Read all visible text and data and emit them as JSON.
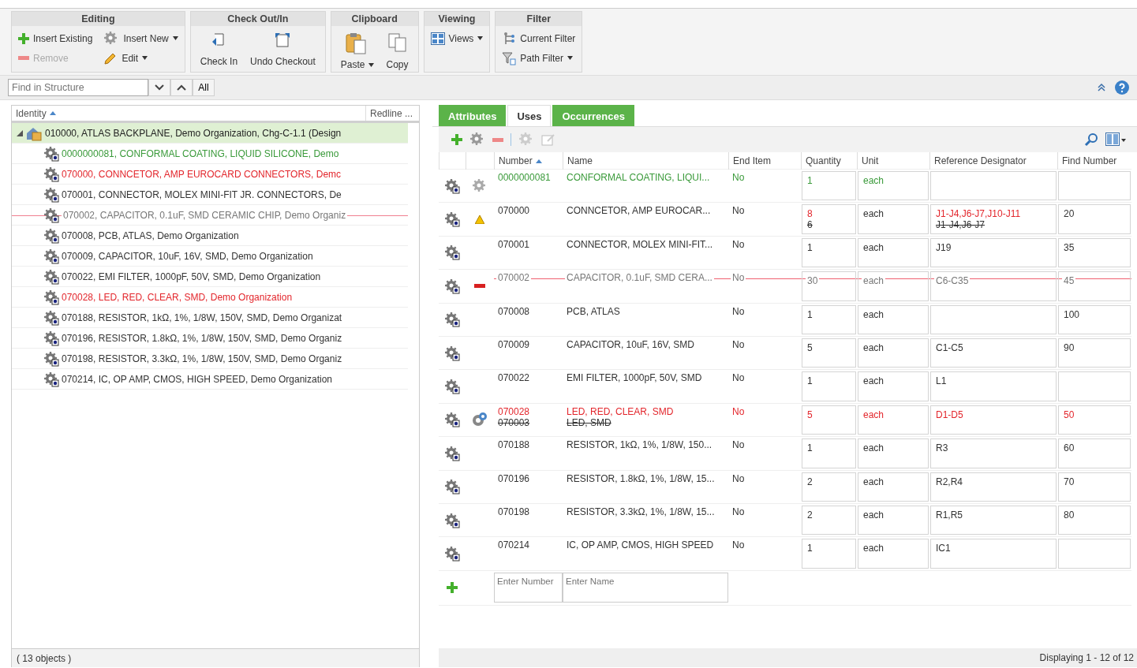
{
  "toolbar": {
    "groups": [
      {
        "title": "Editing",
        "kind": "small",
        "buttons": [
          {
            "label": "Insert Existing",
            "disabled": false,
            "dropdown": false
          },
          {
            "label": "Insert New",
            "disabled": false,
            "dropdown": true
          },
          {
            "label": "Remove",
            "disabled": true,
            "dropdown": false
          },
          {
            "label": "Edit",
            "disabled": false,
            "dropdown": true
          }
        ]
      },
      {
        "title": "Check Out/In",
        "kind": "large",
        "buttons": [
          {
            "label": "Check In",
            "disabled": false,
            "dropdown": false
          },
          {
            "label": "Undo Checkout",
            "disabled": false,
            "dropdown": false
          }
        ]
      },
      {
        "title": "Clipboard",
        "kind": "large",
        "buttons": [
          {
            "label": "Paste",
            "disabled": false,
            "dropdown": true
          },
          {
            "label": "Copy",
            "disabled": false,
            "dropdown": false
          }
        ]
      },
      {
        "title": "Viewing",
        "kind": "small",
        "buttons": [
          {
            "label": "Views",
            "disabled": false,
            "dropdown": true
          }
        ]
      },
      {
        "title": "Filter",
        "kind": "small",
        "buttons": [
          {
            "label": "Current Filter",
            "disabled": false,
            "dropdown": false
          },
          {
            "label": "Path Filter",
            "disabled": false,
            "dropdown": true
          }
        ]
      }
    ]
  },
  "find_bar": {
    "placeholder": "Find in Structure",
    "all_label": "All"
  },
  "structure": {
    "columns": [
      "Identity",
      "Redline ..."
    ],
    "root": {
      "label": "010000, ATLAS BACKPLANE, Demo Organization, Chg-C-1.1 (Design",
      "selected": true,
      "expanded": true,
      "children": [
        {
          "label": "0000000081, CONFORMAL COATING, LIQUID SILICONE, Demo",
          "kind": "added"
        },
        {
          "label": "070000, CONNCETOR,  AMP EUROCARD CONNECTORS, Demc",
          "kind": "changed"
        },
        {
          "label": "070001, CONNECTOR, MOLEX MINI-FIT JR. CONNECTORS, De",
          "kind": "unchanged"
        },
        {
          "label": "070002, CAPACITOR, 0.1uF, SMD CERAMIC CHIP, Demo Organiz",
          "kind": "removed"
        },
        {
          "label": "070008, PCB, ATLAS, Demo Organization",
          "kind": "unchanged"
        },
        {
          "label": "070009, CAPACITOR,  10uF, 16V, SMD, Demo Organization",
          "kind": "unchanged"
        },
        {
          "label": "070022, EMI FILTER, 1000pF, 50V, SMD, Demo Organization",
          "kind": "unchanged"
        },
        {
          "label": "070028, LED, RED, CLEAR, SMD, Demo Organization",
          "kind": "replaced"
        },
        {
          "label": "070188, RESISTOR, 1kΩ, 1%, 1/8W, 150V, SMD, Demo Organizat",
          "kind": "unchanged"
        },
        {
          "label": "070196, RESISTOR, 1.8kΩ, 1%, 1/8W, 150V, SMD, Demo Organiz",
          "kind": "unchanged"
        },
        {
          "label": "070198, RESISTOR, 3.3kΩ, 1%, 1/8W, 150V, SMD, Demo Organiz",
          "kind": "unchanged"
        },
        {
          "label": "070214, IC, OP AMP, CMOS, HIGH SPEED, Demo Organization",
          "kind": "unchanged"
        }
      ]
    },
    "status": "( 13 objects )"
  },
  "tabs": [
    {
      "label": "Attributes",
      "selected": false
    },
    {
      "label": "Uses",
      "selected": true
    },
    {
      "label": "Occurrences",
      "selected": false
    }
  ],
  "uses": {
    "columns": [
      "Number",
      "Name",
      "End Item",
      "Quantity",
      "Unit",
      "Reference Designator",
      "Find Number"
    ],
    "rows": [
      {
        "kind": "added",
        "number": "0000000081",
        "name": "CONFORMAL COATING, LIQUI...",
        "end_item": "No",
        "quantity": "1",
        "unit": "each"
      },
      {
        "kind": "changed",
        "number": "070000",
        "name": "CONNCETOR,  AMP EUROCAR...",
        "end_item": "No",
        "quantity": "8",
        "unit": "each",
        "reference": "J1-J4,J6-J7,J10-J11",
        "find_number": "20",
        "old": {
          "quantity": "6",
          "reference": "J1-J4,J6-J7"
        }
      },
      {
        "kind": "unchanged",
        "number": "070001",
        "name": "CONNECTOR, MOLEX MINI-FIT...",
        "end_item": "No",
        "quantity": "1",
        "unit": "each",
        "reference": "J19",
        "find_number": "35"
      },
      {
        "kind": "removed",
        "number": "070002",
        "name": "CAPACITOR, 0.1uF, SMD CERA...",
        "end_item": "No",
        "quantity": "30",
        "unit": "each",
        "reference": "C6-C35",
        "find_number": "45"
      },
      {
        "kind": "unchanged",
        "number": "070008",
        "name": "PCB, ATLAS",
        "end_item": "No",
        "quantity": "1",
        "unit": "each",
        "find_number": "100"
      },
      {
        "kind": "unchanged",
        "number": "070009",
        "name": "CAPACITOR,  10uF, 16V, SMD",
        "end_item": "No",
        "quantity": "5",
        "unit": "each",
        "reference": "C1-C5",
        "find_number": "90"
      },
      {
        "kind": "unchanged",
        "number": "070022",
        "name": "EMI FILTER, 1000pF, 50V, SMD",
        "end_item": "No",
        "quantity": "1",
        "unit": "each",
        "reference": "L1"
      },
      {
        "kind": "replaced",
        "number": "070028",
        "name": "LED, RED, CLEAR, SMD",
        "end_item": "No",
        "quantity": "5",
        "unit": "each",
        "reference": "D1-D5",
        "find_number": "50",
        "old": {
          "number": "070003",
          "name": "LED, SMD"
        }
      },
      {
        "kind": "unchanged",
        "number": "070188",
        "name": "RESISTOR, 1kΩ, 1%, 1/8W, 150...",
        "end_item": "No",
        "quantity": "1",
        "unit": "each",
        "reference": "R3",
        "find_number": "60"
      },
      {
        "kind": "unchanged",
        "number": "070196",
        "name": "RESISTOR, 1.8kΩ, 1%, 1/8W, 15...",
        "end_item": "No",
        "quantity": "2",
        "unit": "each",
        "reference": "R2,R4",
        "find_number": "70"
      },
      {
        "kind": "unchanged",
        "number": "070198",
        "name": "RESISTOR, 3.3kΩ, 1%, 1/8W, 15...",
        "end_item": "No",
        "quantity": "2",
        "unit": "each",
        "reference": "R1,R5",
        "find_number": "80"
      },
      {
        "kind": "unchanged",
        "number": "070214",
        "name": "IC, OP AMP, CMOS, HIGH SPEED",
        "end_item": "No",
        "quantity": "1",
        "unit": "each",
        "reference": "IC1"
      }
    ],
    "new_row": {
      "number_placeholder": "Enter Number",
      "name_placeholder": "Enter Name"
    },
    "status": "Displaying 1 - 12 of 12"
  }
}
